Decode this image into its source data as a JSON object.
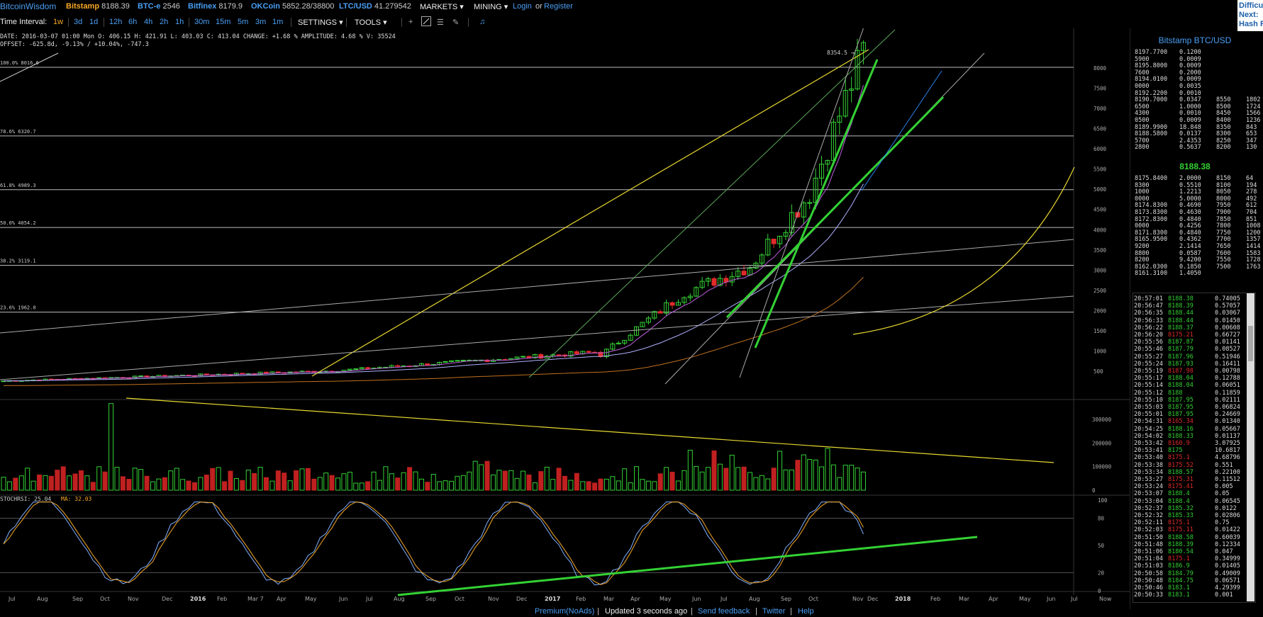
{
  "topbar": {
    "site_name": "BitcoinWisdom",
    "tickers": [
      {
        "name": "Bitstamp",
        "price": "8188.39"
      },
      {
        "name": "BTC-e",
        "price": "2546"
      },
      {
        "name": "Bitfinex",
        "price": "8179.9"
      },
      {
        "name": "OKCoin",
        "price": "5852.28/38800"
      },
      {
        "name": "LTC/USD",
        "price": "41.279542"
      }
    ],
    "markets": "MARKETS",
    "mining": "MINING",
    "login": "Login",
    "or": "or",
    "register": "Register"
  },
  "right_box": {
    "line1": "Difficu",
    "line2": "Next:",
    "line3": "Hash R"
  },
  "toolbar": {
    "label": "Time Interval:",
    "intervals": [
      "1w",
      "3d",
      "1d",
      "12h",
      "6h",
      "4h",
      "2h",
      "1h",
      "30m",
      "15m",
      "5m",
      "3m",
      "1m"
    ],
    "active_interval": "1w",
    "settings": "SETTINGS",
    "tools": "TOOLS"
  },
  "info": {
    "line1": "DATE: 2016-03-07 01:00 Mon    O: 406.15    H: 421.91    L: 403.03    C: 413.04    CHANGE: +1.68 %    AMPLITUDE: 4.68 %    V: 35524",
    "line2": "OFFSET: -625.8d, -9.13% / +10.04%, -747.3"
  },
  "chart": {
    "fib_levels": [
      "100.0% 8016.6",
      "78.6% 6320.7",
      "61.8% 4989.3",
      "50.0% 4054.2",
      "38.2% 3119.1",
      "23.6% 1962.0"
    ],
    "fib_prices": [
      8016.6,
      6320.7,
      4989.3,
      4054.2,
      3119.1,
      1962.0
    ],
    "price_annotation": "8354.5",
    "price_ticks": [
      "8000",
      "7500",
      "7000",
      "6500",
      "6000",
      "5500",
      "5000",
      "4500",
      "4000",
      "3500",
      "3000",
      "2500",
      "2000",
      "1500",
      "1000",
      "500"
    ],
    "volume_ticks": [
      "300000",
      "200000",
      "100000",
      "0"
    ],
    "stoch_label": "STOCHRSI: 25.04",
    "ma_label": "MA: 32.03",
    "stoch_ticks": [
      "100",
      "80",
      "50",
      "20",
      "0"
    ],
    "time_labels": [
      "Jul",
      "Aug",
      "Sep",
      "Oct",
      "Nov",
      "Dec",
      "2016",
      "Feb",
      "Mar 7",
      "Apr",
      "May",
      "Jun",
      "Jul",
      "Aug",
      "Sep",
      "Oct",
      "Nov",
      "Dec",
      "2017",
      "Feb",
      "Mar",
      "Apr",
      "May",
      "Jun",
      "Jul",
      "Aug",
      "Sep",
      "Oct",
      "Nov",
      "Dec",
      "2018",
      "Feb",
      "Mar",
      "Apr",
      "May",
      "Jun",
      "Jul",
      "Now"
    ]
  },
  "orderbook": {
    "title": "Bitstamp BTC/USD",
    "last_price": "8188.38",
    "asks": [
      [
        "8197.7700",
        "0.1200",
        "",
        ""
      ],
      [
        "5900",
        "0.0009",
        "",
        ""
      ],
      [
        "8195.8000",
        "0.0009",
        "",
        ""
      ],
      [
        "7600",
        "0.2000",
        "",
        ""
      ],
      [
        "8194.0100",
        "0.0009",
        "",
        ""
      ],
      [
        "0000",
        "0.0035",
        "",
        ""
      ],
      [
        "8192.2200",
        "0.0010",
        "",
        ""
      ],
      [
        "8190.7000",
        "0.0347",
        "8550",
        "1802"
      ],
      [
        "6500",
        "1.0000",
        "8500",
        "1724"
      ],
      [
        "4300",
        "0.0010",
        "8450",
        "1566"
      ],
      [
        "0500",
        "0.0009",
        "8400",
        "1236"
      ],
      [
        "8189.9900",
        "18.848",
        "8350",
        "843"
      ],
      [
        "8188.5800",
        "0.0137",
        "8300",
        "653"
      ],
      [
        "5700",
        "2.4353",
        "8250",
        "347"
      ],
      [
        "2800",
        "0.5637",
        "8200",
        "130"
      ]
    ],
    "bids": [
      [
        "8175.8400",
        "2.0000",
        "8150",
        "64"
      ],
      [
        "8300",
        "0.5510",
        "8100",
        "194"
      ],
      [
        "1000",
        "1.2213",
        "8050",
        "278"
      ],
      [
        "0000",
        "5.0000",
        "8000",
        "492"
      ],
      [
        "8174.8300",
        "0.4690",
        "7950",
        "612"
      ],
      [
        "8173.8300",
        "0.4630",
        "7900",
        "704"
      ],
      [
        "8172.8300",
        "0.4840",
        "7850",
        "851"
      ],
      [
        "0000",
        "0.4256",
        "7800",
        "1008"
      ],
      [
        "8171.8300",
        "0.4840",
        "7750",
        "1200"
      ],
      [
        "8165.9500",
        "0.4362",
        "7700",
        "1357"
      ],
      [
        "9200",
        "2.1414",
        "7650",
        "1414"
      ],
      [
        "8800",
        "0.0587",
        "7600",
        "1583"
      ],
      [
        "8200",
        "9.4200",
        "7550",
        "1728"
      ],
      [
        "8162.0300",
        "0.1850",
        "7500",
        "1763"
      ],
      [
        "8161.3100",
        "1.4050",
        "",
        ""
      ]
    ]
  },
  "trades": [
    [
      "20:57:01",
      "8188.38",
      "0.74005",
      "g"
    ],
    [
      "20:56:47",
      "8188.39",
      "0.57057",
      "g"
    ],
    [
      "20:56:35",
      "8188.44",
      "0.03067",
      "g"
    ],
    [
      "20:56:33",
      "8188.44",
      "0.01450",
      "g"
    ],
    [
      "20:56:22",
      "8188.37",
      "0.00608",
      "g"
    ],
    [
      "20:56:20",
      "8175.21",
      "0.66727",
      "r"
    ],
    [
      "20:55:56",
      "8187.87",
      "0.01141",
      "g"
    ],
    [
      "20:55:46",
      "8187.79",
      "0.08527",
      "g"
    ],
    [
      "20:55:27",
      "8187.96",
      "0.51946",
      "g"
    ],
    [
      "20:55:24",
      "8187.93",
      "0.16411",
      "g"
    ],
    [
      "20:55:19",
      "8187.98",
      "0.00798",
      "r"
    ],
    [
      "20:55:17",
      "8188.04",
      "0.12788",
      "g"
    ],
    [
      "20:55:14",
      "8188.04",
      "0.06051",
      "g"
    ],
    [
      "20:55:12",
      "8188",
      "0.11859",
      "g"
    ],
    [
      "20:55:10",
      "8187.95",
      "0.02111",
      "g"
    ],
    [
      "20:55:03",
      "8187.95",
      "0.06824",
      "g"
    ],
    [
      "20:55:01",
      "8187.95",
      "0.24669",
      "g"
    ],
    [
      "20:54:31",
      "8165.34",
      "0.01340",
      "r"
    ],
    [
      "20:54:25",
      "8188.16",
      "0.05667",
      "g"
    ],
    [
      "20:54:02",
      "8188.33",
      "0.01137",
      "g"
    ],
    [
      "20:53:42",
      "8160.9",
      "3.07925",
      "r"
    ],
    [
      "20:53:41",
      "8175",
      "10.6817",
      "g"
    ],
    [
      "20:53:40",
      "8175.1",
      "4.68796",
      "r"
    ],
    [
      "20:53:38",
      "8175.52",
      "0.551",
      "r"
    ],
    [
      "20:53:34",
      "8188.57",
      "0.22100",
      "g"
    ],
    [
      "20:53:27",
      "8175.31",
      "0.11512",
      "r"
    ],
    [
      "20:53:24",
      "8175.41",
      "0.005",
      "r"
    ],
    [
      "20:53:07",
      "8188.4",
      "0.05",
      "g"
    ],
    [
      "20:53:04",
      "8188.4",
      "0.06545",
      "g"
    ],
    [
      "20:52:37",
      "8185.32",
      "0.0122",
      "g"
    ],
    [
      "20:52:32",
      "8185.33",
      "0.02806",
      "g"
    ],
    [
      "20:52:11",
      "8175.1",
      "0.75",
      "r"
    ],
    [
      "20:52:03",
      "8175.11",
      "0.01422",
      "r"
    ],
    [
      "20:51:50",
      "8188.58",
      "0.60039",
      "g"
    ],
    [
      "20:51:48",
      "8188.39",
      "0.12334",
      "g"
    ],
    [
      "20:51:06",
      "8180.54",
      "0.047",
      "g"
    ],
    [
      "20:51:04",
      "8175.1",
      "0.34999",
      "r"
    ],
    [
      "20:51:03",
      "8186.9",
      "0.01405",
      "g"
    ],
    [
      "20:50:58",
      "8184.79",
      "0.49009",
      "g"
    ],
    [
      "20:50:48",
      "8184.75",
      "0.06571",
      "g"
    ],
    [
      "20:50:46",
      "8183.1",
      "4.29399",
      "g"
    ],
    [
      "20:50:33",
      "8183.1",
      "0.001",
      "g"
    ]
  ],
  "footer": {
    "premium": "Premium(NoAds)",
    "updated": "Updated 3 seconds ago",
    "feedback": "Send feedback",
    "twitter": "Twitter",
    "help": "Help"
  },
  "colors": {
    "accent_blue": "#4a9ff5",
    "accent_orange": "#f7a828",
    "up_green": "#34d134",
    "down_red": "#e02b2b"
  }
}
